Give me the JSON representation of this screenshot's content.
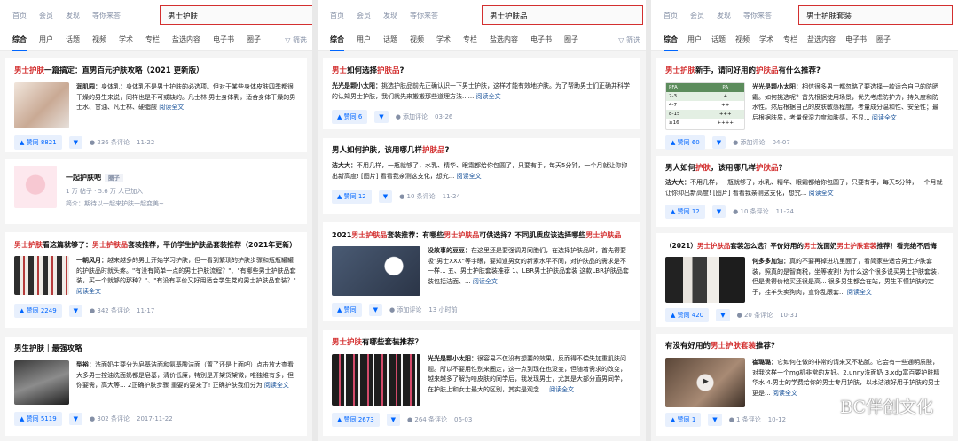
{
  "nav": [
    "首页",
    "会员",
    "发现",
    "等你来答"
  ],
  "tabs": [
    "综合",
    "用户",
    "话题",
    "视频",
    "学术",
    "专栏",
    "盐选内容",
    "电子书",
    "圈子"
  ],
  "filter_label": "筛选",
  "p1": {
    "search": "男士护肤",
    "c1": {
      "t_a": "男士护肤",
      "t_b": "一篇搞定：直男百元护肤攻略（2021 更新版）",
      "label": "润肌园：",
      "body": "身体乳：身体乳不是男士护肤的必选项。但对于某些身体皮肤四季都很干燥的男生来说，同样也是不可或缺的。凡士林 男士身体乳，适合身体干燥的男士水、甘油、凡士林、硬脂酸",
      "more": "阅读全文",
      "vote": "赞同 8821",
      "comments": "236 条评论",
      "date": "11-22"
    },
    "c2": {
      "name": "一起护肤吧",
      "badge": "圈子",
      "stats": "1 万 帖子 · 5.6 万 人已加入",
      "intro": "简介：期待以一起来护肤一起变美~"
    },
    "c3": {
      "t_a": "男士护肤",
      "t_b": "看这篇就够了：",
      "t_c": "男士护肤品",
      "t_d": "套装推荐，平价学生护肤品套装推荐（2021年更新）",
      "label": "一朝风月：",
      "body": "越来越多的男士开始学习护肤，但一看到繁琐的护肤步骤和瓶瓶罐罐的护肤品时就头疼。\"有没有简单一点的男士护肤流程？\"、\"有哪些男士护肤品套装，买一个就够的那种？\"、\"有没有平价又好用适合学生党的男士护肤品套装？\"",
      "more": "阅读全文",
      "vote": "赞同 2249",
      "comments": "342 条评论",
      "date": "11-17"
    },
    "c4": {
      "t_a": "男生护肤",
      "t_b": "｜最强攻略",
      "label": "型裕：",
      "body": "洗面奶主要分为皂基洁面和氨基酸洁面（置了还是上面吧）点击放大查看 大多男士控油洗面奶都是皂基，清价低廉，特别是开架货架微，唯独维有多，但你要需，高大等... 2正确护肤步骤 重要的要来了! 正确护肤我们分为",
      "more": "阅读全文",
      "vote": "赞同 5119",
      "comments": "302 条评论",
      "date": "2017-11-22"
    }
  },
  "p2": {
    "search": "男士护肤品",
    "c1": {
      "t_a": "男士",
      "t_b": "如何选择",
      "t_c": "护肤品",
      "t_d": "?",
      "label": "光光是颗小太阳：",
      "body": "挑选护肤品前先正确认识一下男士护肤，这样才能有效地护肤。为了帮助男士们正确并科学的认知男士护肤，我们就先来搬搬那些道理方法......",
      "more": "阅读全文",
      "vote": "赞同 6",
      "comments": "添加评论",
      "date": "03-26"
    },
    "c2": {
      "t_a": "男人如何护肤，该用哪几样",
      "t_b": "护肤品",
      "t_c": "?",
      "label": "洁大大：",
      "body": "不用几样，一瓶就够了，水乳、精华、眼霜都给你包圆了，只要有手，每天5分钟，一个月就让你抑出新高度! [图片] 看看我亲测这支化，想究...",
      "more": "阅读全文",
      "vote": "赞同 12",
      "comments": "10 条评论",
      "date": "11-24"
    },
    "c3": {
      "t_a": "2021",
      "t_b": "男士护肤品",
      "t_c": "套装推荐：有哪些",
      "t_d": "男士护肤品",
      "t_e": "可供选择？不同肌质应该选择哪些",
      "t_f": "男士护肤品",
      "label": "没故事的豆豆：",
      "body": "在这里还是要强调男同胞们，在选择护肤品时，首先得要吸\"男士XXX\"等字眼，要知道男女的新素水平不同，对护肤品的需求是不一样... 五、男士护肤套装推荐 1、LBR男士护肤品套装 这款LBR护肤品套装包括洁面、...",
      "more": "阅读全文",
      "vote": "赞同",
      "comments": "添加评论",
      "date": "13 小时前"
    },
    "c4": {
      "t_a": "男士护肤",
      "t_b": "有哪些套装推荐？",
      "label": "光光是颗小太阳：",
      "body": "很容易不仅没有想要的效果，反而得不偿失加重肌肤问题。所以不要用性别来圈定，这一点到现在也没变，但随着需求的改变，越来越多了解为啥皮肤的同学后，我发现男士，尤其是大部分直男同学，在护肤上和女士最大的区别，其实是观念....",
      "more": "阅读全文",
      "vote": "赞同 2673",
      "comments": "264 条评论",
      "date": "06-03"
    }
  },
  "p3": {
    "search": "男士护肤套装",
    "c1": {
      "t_a": "男士护肤",
      "t_b": "新手，请问好用的",
      "t_c": "护肤品",
      "t_d": "有什么推荐?",
      "label": "光光是颗小太阳：",
      "body": "相信很多男士都忽略了要选择一款适合自己的防晒霜。如何挑选呢？首先根据使用场景，优先考虑防护力，持久度和防水性。然后根据自己的皮肤敏感程度，考量成分温和性、安全性；最后根据肤质，考量保湿力度和肤感，不显...",
      "more": "阅读全文",
      "vote": "赞同 60",
      "comments": "添加评论",
      "date": "04-07",
      "spf": [
        [
          "PFA",
          "PA"
        ],
        [
          "2-3",
          "+"
        ],
        [
          "4-7",
          "++"
        ],
        [
          "8-15",
          "+++"
        ],
        [
          "≥16",
          "++++"
        ]
      ]
    },
    "c2": {
      "t_a": "男人如何",
      "t_b": "护肤",
      "t_c": "，该用哪几样",
      "t_d": "护肤品",
      "t_e": "?",
      "label": "洁大大：",
      "body": "不用几样，一瓶就够了，水乳、精华、眼霜都给你包圆了，只要有手，每天5分钟，一个月就让你抑出新高度! [图片] 看看我亲测这支化，想究...",
      "more": "阅读全文",
      "vote": "赞同 12",
      "comments": "10 条评论",
      "date": "11-24"
    },
    "c3": {
      "t_a": "（2021）",
      "t_b": "男士护肤品",
      "t_c": "套装怎么选？平价好用的",
      "t_d": "男士",
      "t_e": "洗面奶",
      "t_f": "男士护肤套装",
      "t_g": "推荐！看完绝不后悔",
      "label": "何多多加油：",
      "body": "真的不要再掉进坑里面了，看简家些适合男士护肤套装，照真的是智商税，坐等被割! 为什么这个很多说买男士护肤套装，但是贵得价格买还很是高... 很多男生都会在站，男生不懂护肤的定子，挂羊头卖狗肉，宣你乱跟套...",
      "more": "阅读全文",
      "vote": "赞同 420",
      "comments": "20 条评论",
      "date": "10-31"
    },
    "c4": {
      "t_a": "有没有好用的",
      "t_b": "男士护肤套装",
      "t_c": "推荐?",
      "label": "崔璐璐：",
      "body": "它如何在做的非常的请来又不粘腻。它会有一些通明质酸，对我这样一个mg机非常的友好。2.unny洗面奶 3.xdg富百要护肤精华水 4.男士的学费给你的男士专用护肤，以水洁液好用于护肤的男士更是...",
      "more": "阅读全文",
      "vote": "赞同 1",
      "comments": "1 条评论",
      "date": "10-12"
    }
  },
  "watermark": "BC伴创文化"
}
